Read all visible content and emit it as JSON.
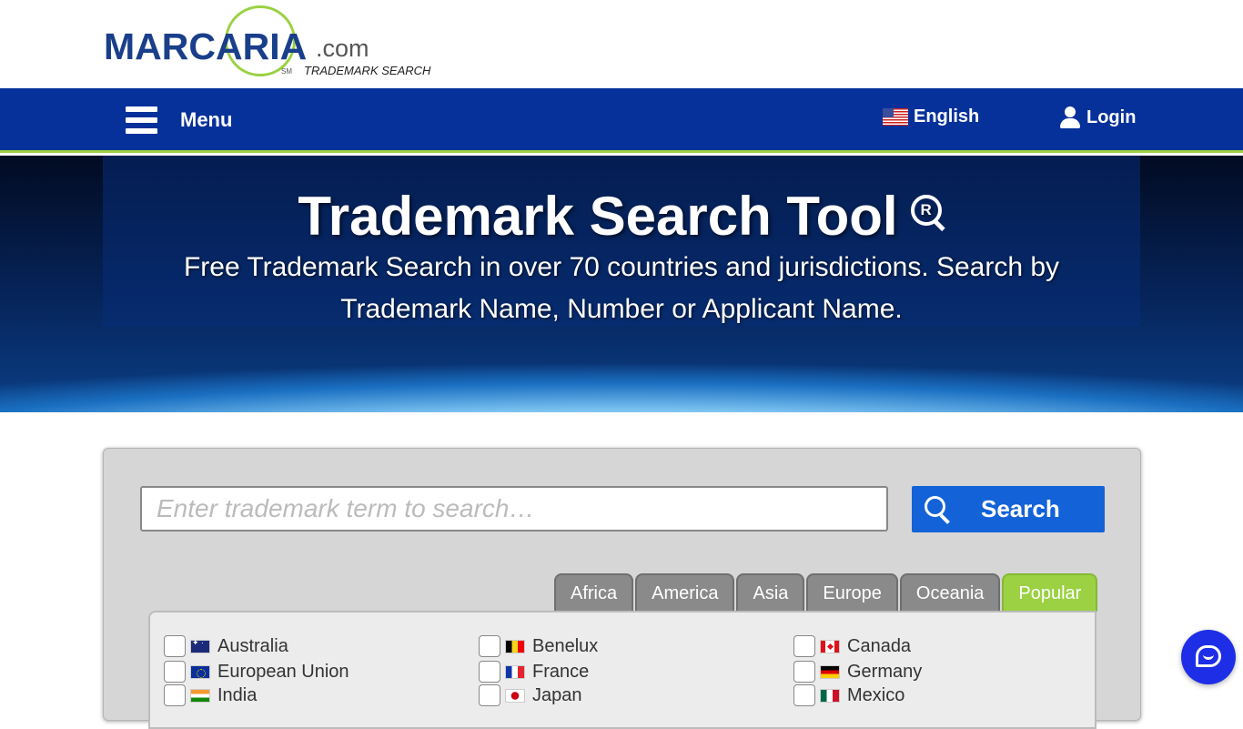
{
  "header": {
    "logo_text": "MARCARIA",
    "logo_suffix": ".com",
    "logo_sm": "SM",
    "logo_subtitle": "TRADEMARK SEARCH"
  },
  "nav": {
    "menu_label": "Menu",
    "language_label": "English",
    "login_label": "Login"
  },
  "hero": {
    "title": "Trademark Search Tool",
    "subtitle": "Free Trademark Search in over 70 countries and jurisdictions. Search by Trademark Name, Number or Applicant Name."
  },
  "search": {
    "placeholder": "Enter trademark term to search…",
    "button_label": "Search"
  },
  "region_tabs": [
    {
      "label": "Africa",
      "active": false
    },
    {
      "label": "America",
      "active": false
    },
    {
      "label": "Asia",
      "active": false
    },
    {
      "label": "Europe",
      "active": false
    },
    {
      "label": "Oceania",
      "active": false
    },
    {
      "label": "Popular",
      "active": true
    }
  ],
  "countries": [
    {
      "name": "Australia",
      "flag": "au-flag-icon"
    },
    {
      "name": "Benelux",
      "flag": "benelux-flag-icon"
    },
    {
      "name": "Canada",
      "flag": "ca-flag-icon"
    },
    {
      "name": "European Union",
      "flag": "eu-flag-icon"
    },
    {
      "name": "France",
      "flag": "fr-flag-icon"
    },
    {
      "name": "Germany",
      "flag": "de-flag-icon"
    },
    {
      "name": "India",
      "flag": "in-flag-icon"
    },
    {
      "name": "Japan",
      "flag": "jp-flag-icon"
    },
    {
      "name": "Mexico",
      "flag": "mx-flag-icon"
    }
  ],
  "colors": {
    "nav_blue": "#06319a",
    "accent_green": "#9bd143",
    "search_button": "#1362d8",
    "chat_button": "#1d2ee6"
  }
}
